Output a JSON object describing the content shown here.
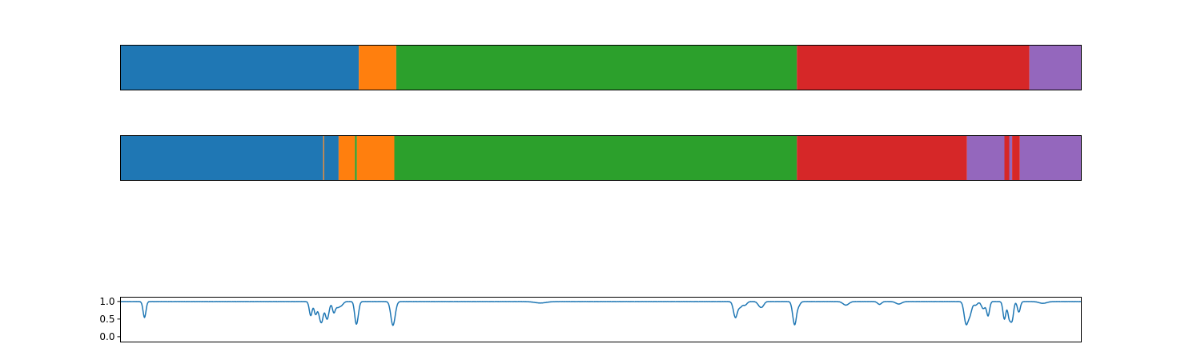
{
  "chart_data": [
    {
      "type": "segmentation",
      "title": "",
      "xlabel": "",
      "ylabel": "",
      "xlim": [
        0,
        1000
      ],
      "segments": [
        {
          "start": 0,
          "end": 248,
          "label": 0
        },
        {
          "start": 248,
          "end": 287,
          "label": 1
        },
        {
          "start": 287,
          "end": 704,
          "label": 2
        },
        {
          "start": 704,
          "end": 946,
          "label": 3
        },
        {
          "start": 946,
          "end": 1000,
          "label": 4
        }
      ]
    },
    {
      "type": "segmentation",
      "title": "",
      "xlabel": "",
      "ylabel": "",
      "xlim": [
        0,
        1000
      ],
      "segments": [
        {
          "start": 0,
          "end": 211,
          "label": 0
        },
        {
          "start": 211,
          "end": 212,
          "label": 1
        },
        {
          "start": 212,
          "end": 227,
          "label": 0
        },
        {
          "start": 227,
          "end": 244,
          "label": 1
        },
        {
          "start": 244,
          "end": 246,
          "label": 2
        },
        {
          "start": 246,
          "end": 285,
          "label": 1
        },
        {
          "start": 285,
          "end": 704,
          "label": 2
        },
        {
          "start": 704,
          "end": 881,
          "label": 3
        },
        {
          "start": 881,
          "end": 920,
          "label": 4
        },
        {
          "start": 920,
          "end": 925,
          "label": 3
        },
        {
          "start": 925,
          "end": 928,
          "label": 4
        },
        {
          "start": 928,
          "end": 936,
          "label": 3
        },
        {
          "start": 936,
          "end": 1000,
          "label": 4
        }
      ]
    },
    {
      "type": "line",
      "title": "",
      "xlabel": "",
      "ylabel": "",
      "xlim": [
        0,
        1000
      ],
      "ylim": [
        -0.15,
        1.12
      ],
      "yticks": [
        "0.0",
        "0.5",
        "1.0"
      ],
      "baseline": 1.0,
      "dips": [
        [
          25,
          0.55,
          1.5
        ],
        [
          198,
          0.6,
          1.5
        ],
        [
          203,
          0.65,
          1.5
        ],
        [
          208,
          0.55,
          2
        ],
        [
          210,
          0.75,
          1.5
        ],
        [
          215,
          0.5,
          2
        ],
        [
          222,
          0.7,
          1.5
        ],
        [
          226,
          0.85,
          2
        ],
        [
          230,
          0.9,
          2
        ],
        [
          245,
          0.5,
          1.5
        ],
        [
          247,
          0.72,
          1.5
        ],
        [
          283,
          0.5,
          2
        ],
        [
          285,
          0.75,
          2
        ],
        [
          437,
          0.96,
          6
        ],
        [
          640,
          0.55,
          2
        ],
        [
          645,
          0.85,
          2
        ],
        [
          650,
          0.9,
          2
        ],
        [
          665,
          0.9,
          2
        ],
        [
          668,
          0.88,
          2
        ],
        [
          700,
          0.75,
          1.5
        ],
        [
          702,
          0.5,
          1.5
        ],
        [
          705,
          0.85,
          2
        ],
        [
          755,
          0.9,
          3
        ],
        [
          790,
          0.92,
          2
        ],
        [
          810,
          0.93,
          3
        ],
        [
          880,
          0.4,
          2
        ],
        [
          884,
          0.65,
          2
        ],
        [
          890,
          0.9,
          2
        ],
        [
          898,
          0.8,
          2
        ],
        [
          903,
          0.6,
          1.5
        ],
        [
          920,
          0.5,
          1.5
        ],
        [
          925,
          0.55,
          1.5
        ],
        [
          928,
          0.5,
          1.5
        ],
        [
          935,
          0.7,
          1.5
        ],
        [
          960,
          0.95,
          4
        ]
      ]
    }
  ],
  "colors": {
    "palette": [
      "#1f77b4",
      "#ff7f0e",
      "#2ca02c",
      "#d62728",
      "#9467bd"
    ],
    "line": "#1f77b4"
  }
}
